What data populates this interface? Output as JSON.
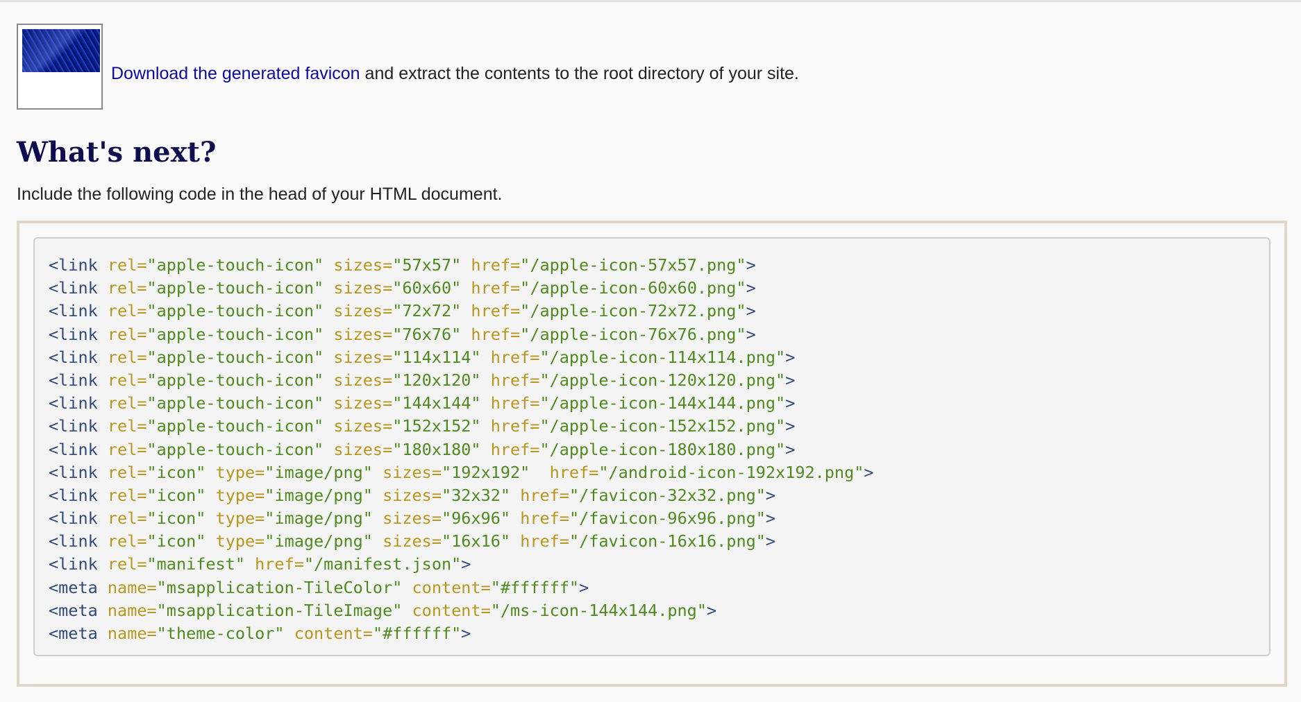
{
  "download": {
    "link_text": "Download the generated favicon",
    "rest_text": " and extract the contents to the root directory of your site."
  },
  "heading": "What's next?",
  "intro": "Include the following code in the head of your HTML document.",
  "colors": {
    "tag": "#2f4a7a",
    "attribute": "#b8951d",
    "value": "#4f8a1f",
    "link": "#0b0b9e",
    "heading": "#0e0e4f"
  },
  "code_lines": [
    {
      "tag": "link",
      "attrs": [
        [
          "rel",
          "\"apple-touch-icon\""
        ],
        [
          "sizes",
          "\"57x57\""
        ],
        [
          "href",
          "\"/apple-icon-57x57.png\""
        ]
      ]
    },
    {
      "tag": "link",
      "attrs": [
        [
          "rel",
          "\"apple-touch-icon\""
        ],
        [
          "sizes",
          "\"60x60\""
        ],
        [
          "href",
          "\"/apple-icon-60x60.png\""
        ]
      ]
    },
    {
      "tag": "link",
      "attrs": [
        [
          "rel",
          "\"apple-touch-icon\""
        ],
        [
          "sizes",
          "\"72x72\""
        ],
        [
          "href",
          "\"/apple-icon-72x72.png\""
        ]
      ]
    },
    {
      "tag": "link",
      "attrs": [
        [
          "rel",
          "\"apple-touch-icon\""
        ],
        [
          "sizes",
          "\"76x76\""
        ],
        [
          "href",
          "\"/apple-icon-76x76.png\""
        ]
      ]
    },
    {
      "tag": "link",
      "attrs": [
        [
          "rel",
          "\"apple-touch-icon\""
        ],
        [
          "sizes",
          "\"114x114\""
        ],
        [
          "href",
          "\"/apple-icon-114x114.png\""
        ]
      ]
    },
    {
      "tag": "link",
      "attrs": [
        [
          "rel",
          "\"apple-touch-icon\""
        ],
        [
          "sizes",
          "\"120x120\""
        ],
        [
          "href",
          "\"/apple-icon-120x120.png\""
        ]
      ]
    },
    {
      "tag": "link",
      "attrs": [
        [
          "rel",
          "\"apple-touch-icon\""
        ],
        [
          "sizes",
          "\"144x144\""
        ],
        [
          "href",
          "\"/apple-icon-144x144.png\""
        ]
      ]
    },
    {
      "tag": "link",
      "attrs": [
        [
          "rel",
          "\"apple-touch-icon\""
        ],
        [
          "sizes",
          "\"152x152\""
        ],
        [
          "href",
          "\"/apple-icon-152x152.png\""
        ]
      ]
    },
    {
      "tag": "link",
      "attrs": [
        [
          "rel",
          "\"apple-touch-icon\""
        ],
        [
          "sizes",
          "\"180x180\""
        ],
        [
          "href",
          "\"/apple-icon-180x180.png\""
        ]
      ]
    },
    {
      "tag": "link",
      "attrs": [
        [
          "rel",
          "\"icon\""
        ],
        [
          "type",
          "\"image/png\""
        ],
        [
          "sizes",
          "\"192x192\" "
        ],
        [
          "href",
          "\"/android-icon-192x192.png\""
        ]
      ]
    },
    {
      "tag": "link",
      "attrs": [
        [
          "rel",
          "\"icon\""
        ],
        [
          "type",
          "\"image/png\""
        ],
        [
          "sizes",
          "\"32x32\""
        ],
        [
          "href",
          "\"/favicon-32x32.png\""
        ]
      ]
    },
    {
      "tag": "link",
      "attrs": [
        [
          "rel",
          "\"icon\""
        ],
        [
          "type",
          "\"image/png\""
        ],
        [
          "sizes",
          "\"96x96\""
        ],
        [
          "href",
          "\"/favicon-96x96.png\""
        ]
      ]
    },
    {
      "tag": "link",
      "attrs": [
        [
          "rel",
          "\"icon\""
        ],
        [
          "type",
          "\"image/png\""
        ],
        [
          "sizes",
          "\"16x16\""
        ],
        [
          "href",
          "\"/favicon-16x16.png\""
        ]
      ]
    },
    {
      "tag": "link",
      "attrs": [
        [
          "rel",
          "\"manifest\""
        ],
        [
          "href",
          "\"/manifest.json\""
        ]
      ]
    },
    {
      "tag": "meta",
      "attrs": [
        [
          "name",
          "\"msapplication-TileColor\""
        ],
        [
          "content",
          "\"#ffffff\""
        ]
      ]
    },
    {
      "tag": "meta",
      "attrs": [
        [
          "name",
          "\"msapplication-TileImage\""
        ],
        [
          "content",
          "\"/ms-icon-144x144.png\""
        ]
      ]
    },
    {
      "tag": "meta",
      "attrs": [
        [
          "name",
          "\"theme-color\""
        ],
        [
          "content",
          "\"#ffffff\""
        ]
      ]
    }
  ]
}
